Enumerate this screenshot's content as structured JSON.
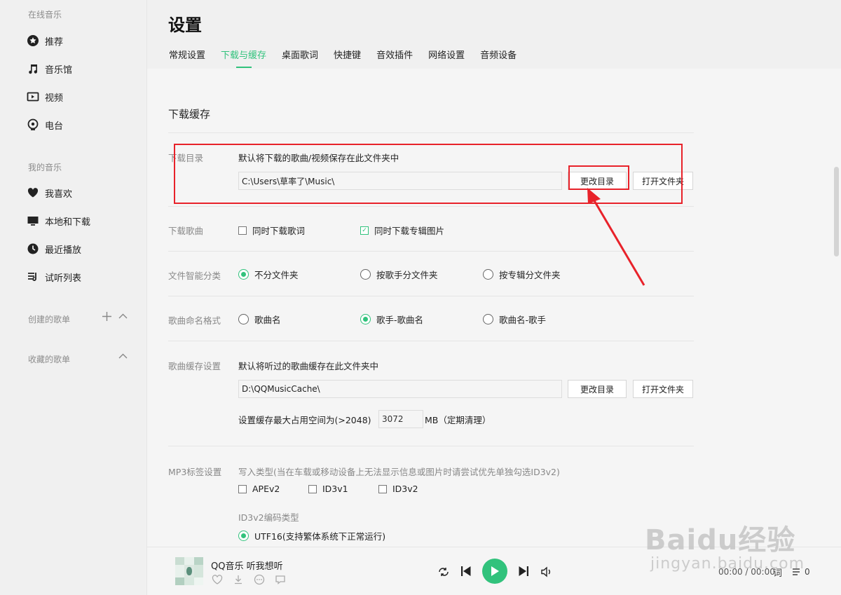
{
  "sidebar": {
    "online_section": "在线音乐",
    "online_items": [
      {
        "label": "推荐",
        "icon": "star-circle-icon"
      },
      {
        "label": "音乐馆",
        "icon": "music-note-icon"
      },
      {
        "label": "视频",
        "icon": "video-icon"
      },
      {
        "label": "电台",
        "icon": "radio-icon"
      }
    ],
    "my_section": "我的音乐",
    "my_items": [
      {
        "label": "我喜欢",
        "icon": "heart-icon"
      },
      {
        "label": "本地和下载",
        "icon": "monitor-icon"
      },
      {
        "label": "最近播放",
        "icon": "clock-icon"
      },
      {
        "label": "试听列表",
        "icon": "playlist-icon"
      }
    ],
    "created_section": "创建的歌单",
    "collected_section": "收藏的歌单"
  },
  "header": {
    "title": "设置",
    "tabs": [
      {
        "label": "常规设置",
        "active": false
      },
      {
        "label": "下载与缓存",
        "active": true
      },
      {
        "label": "桌面歌词",
        "active": false
      },
      {
        "label": "快捷键",
        "active": false
      },
      {
        "label": "音效插件",
        "active": false
      },
      {
        "label": "网络设置",
        "active": false
      },
      {
        "label": "音频设备",
        "active": false
      }
    ]
  },
  "settings": {
    "section_title": "下载缓存",
    "download_dir": {
      "label": "下载目录",
      "desc": "默认将下载的歌曲/视频保存在此文件夹中",
      "path": "C:\\Users\\草率了\\Music\\",
      "change_btn": "更改目录",
      "open_btn": "打开文件夹"
    },
    "download_song": {
      "label": "下载歌曲",
      "opt_lyrics": "同时下载歌词",
      "opt_lyrics_checked": false,
      "opt_cover": "同时下载专辑图片",
      "opt_cover_checked": true
    },
    "smart_category": {
      "label": "文件智能分类",
      "options": [
        "不分文件夹",
        "按歌手分文件夹",
        "按专辑分文件夹"
      ],
      "selected": 0
    },
    "naming_format": {
      "label": "歌曲命名格式",
      "options": [
        "歌曲名",
        "歌手-歌曲名",
        "歌曲名-歌手"
      ],
      "selected": 1
    },
    "cache": {
      "label": "歌曲缓存设置",
      "desc": "默认将听过的歌曲缓存在此文件夹中",
      "path": "D:\\QQMusicCache\\",
      "change_btn": "更改目录",
      "open_btn": "打开文件夹",
      "max_prefix": "设置缓存最大占用空间为(>2048)",
      "max_value": "3072",
      "max_suffix": "MB（定期清理）"
    },
    "mp3_tag": {
      "label": "MP3标签设置",
      "desc": "写入类型(当在车载或移动设备上无法显示信息或图片时请尝试优先单独勾选ID3v2)",
      "types": [
        "APEv2",
        "ID3v1",
        "ID3v2"
      ],
      "encoding_label": "ID3v2编码类型",
      "encoding_option": "UTF16(支持繁体系统下正常运行)"
    }
  },
  "player": {
    "song": "QQ音乐 听我想听",
    "time": "00:00 / 00:00",
    "lyrics_btn": "词",
    "queue_count": "0"
  },
  "watermark": {
    "brand": "Baidu经验",
    "site": "jingyan.baidu.com"
  },
  "colors": {
    "accent": "#31c27c",
    "annotation": "#e8222a"
  }
}
